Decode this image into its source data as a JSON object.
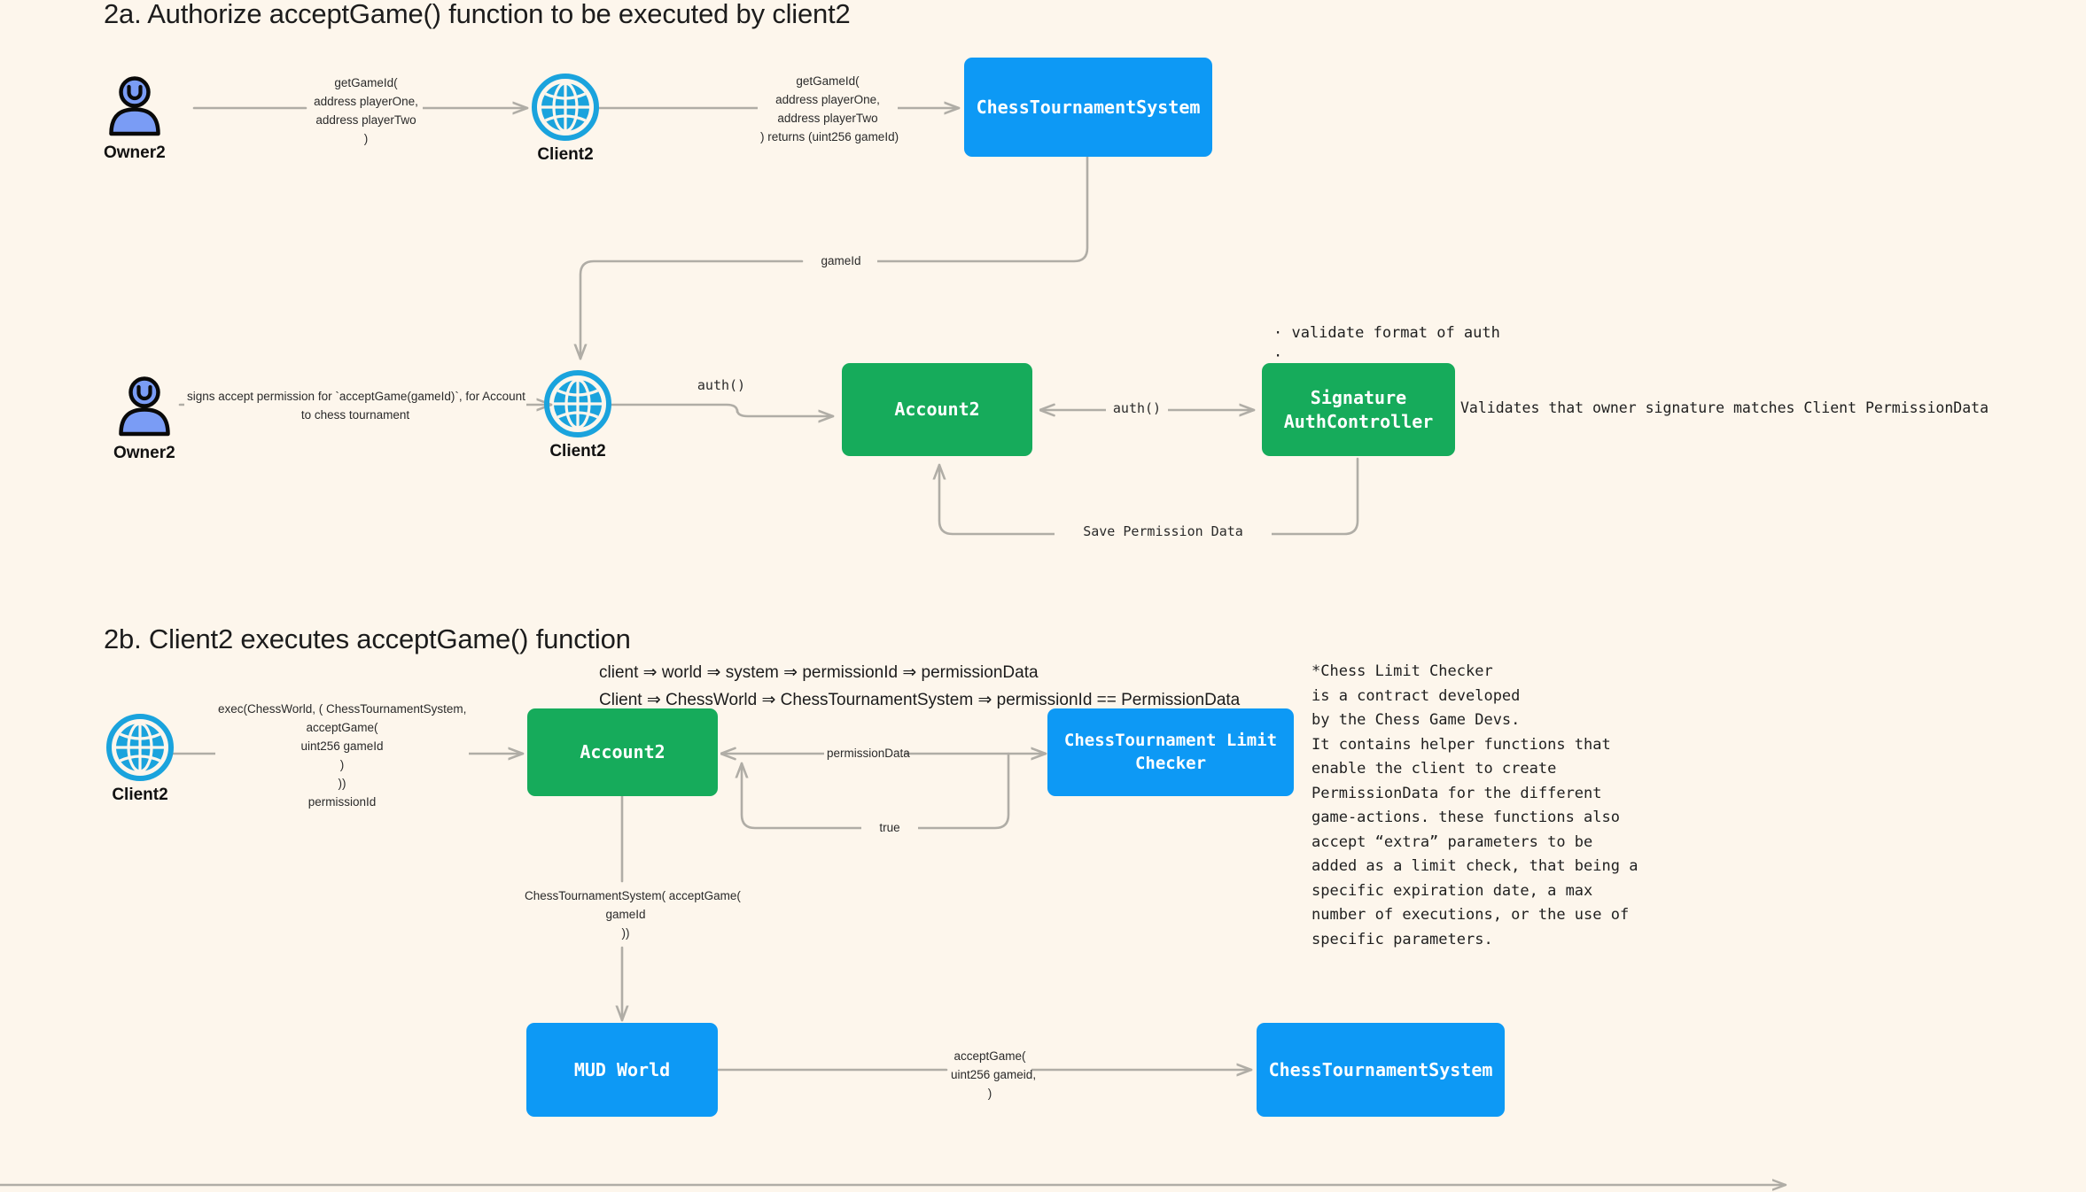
{
  "theme": {
    "background": "#fdf6ec",
    "blue": "#0d99f5",
    "green": "#16ab5b",
    "edge": "#b0ada6",
    "actor_fill": "#7a9cf5",
    "globe": "#1aa3dd",
    "text": "#1c1c1c"
  },
  "sections": {
    "a": {
      "title": "2a. Authorize acceptGame() function to be executed by client2"
    },
    "b": {
      "title": "2b. Client2 executes acceptGame() function"
    }
  },
  "nodes": {
    "owner2_top": {
      "label": "Owner2",
      "icon": "person-icon"
    },
    "client2_top": {
      "label": "Client2",
      "icon": "globe-icon"
    },
    "chess_tournament_system_top": {
      "label": "ChessTournamentSystem"
    },
    "owner2_mid": {
      "label": "Owner2",
      "icon": "person-icon"
    },
    "client2_mid": {
      "label": "Client2",
      "icon": "globe-icon"
    },
    "account2_mid": {
      "label": "Account2"
    },
    "signature_auth_controller": {
      "label": "Signature\nAuthController"
    },
    "client2_bottom": {
      "label": "Client2",
      "icon": "globe-icon"
    },
    "account2_bottom": {
      "label": "Account2"
    },
    "chess_limit_checker": {
      "label": "ChessTournament Limit\nChecker"
    },
    "mud_world": {
      "label": "MUD World"
    },
    "chess_tournament_system_bottom": {
      "label": "ChessTournamentSystem"
    }
  },
  "edges": {
    "owner_to_client_top": "getGameId(\naddress playerOne,\naddress playerTwo\n)",
    "client_to_system_top": "getGameId(\naddress playerOne,\naddress playerTwo\n) returns (uint256 gameId)",
    "system_to_client_gameid": "gameId",
    "owner_to_client_mid": "signs accept permission for `acceptGame(gameId)`, for Account\nto chess tournament",
    "client_to_account_auth": "auth()",
    "account_to_sigauth": "auth()",
    "save_permission_data": "Save Permission Data",
    "client_to_account_exec": "exec(ChessWorld, ( ChessTournamentSystem,\nacceptGame(\nuint256 gameId\n)\n))\npermissionId",
    "account_to_limitchecker": "permissionData",
    "limitchecker_to_account": "true",
    "account_to_world": "ChessTournamentSystem( acceptGame(\ngameId\n))",
    "world_to_system": "acceptGame(\nuint256 gameid,\n)"
  },
  "annotations": {
    "sigauth_bullets": "· validate format of auth\n·",
    "sigauth_validates": "Validates that owner signature matches Client PermissionData",
    "permission_mapping": "client ⇒ world ⇒ system ⇒ permissionId ⇒ permissionData\nClient ⇒ ChessWorld ⇒ ChessTournamentSystem ⇒ permissionId == PermissionData",
    "limit_checker_note": "*Chess Limit Checker\nis a contract developed\nby the Chess Game Devs.\nIt contains helper functions that\nenable the client to create\nPermissionData for the different\ngame-actions. these functions also\naccept “extra” parameters to be\nadded as a limit check, that being a\nspecific expiration date, a max\nnumber of executions, or the use of\nspecific parameters."
  }
}
